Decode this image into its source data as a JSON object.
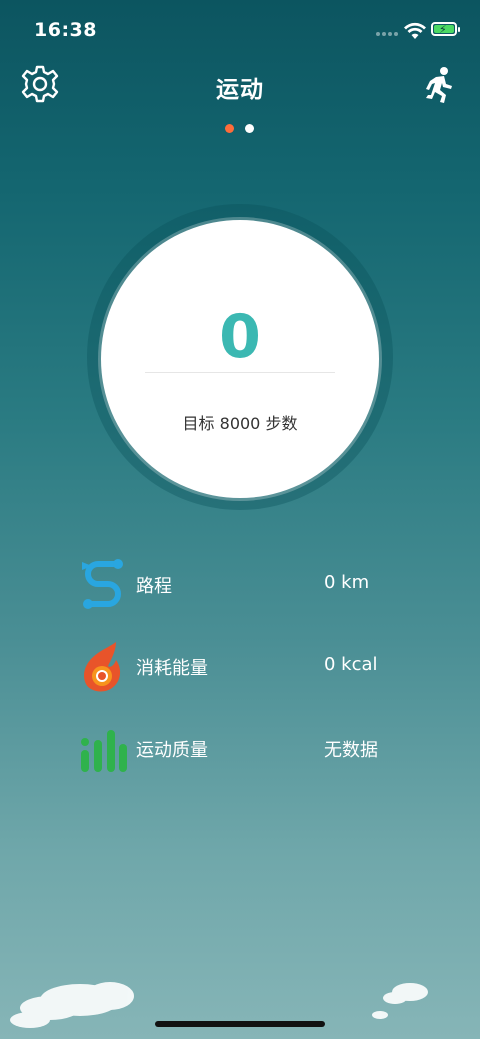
{
  "status_bar": {
    "time": "16:38"
  },
  "header": {
    "title": "运动"
  },
  "pager": {
    "active_index": 0,
    "count": 2
  },
  "steps": {
    "count": "0",
    "goal_text": "目标 8000 步数"
  },
  "stats": [
    {
      "label": "路程",
      "value": "0 km",
      "icon": "route-icon"
    },
    {
      "label": "消耗能量",
      "value": "0 kcal",
      "icon": "flame-icon"
    },
    {
      "label": "运动质量",
      "value": "无数据",
      "icon": "bar-chart-icon"
    }
  ],
  "colors": {
    "accent": "#3bb8b2",
    "active_dot": "#ff6c3a",
    "battery": "#4cd964"
  }
}
